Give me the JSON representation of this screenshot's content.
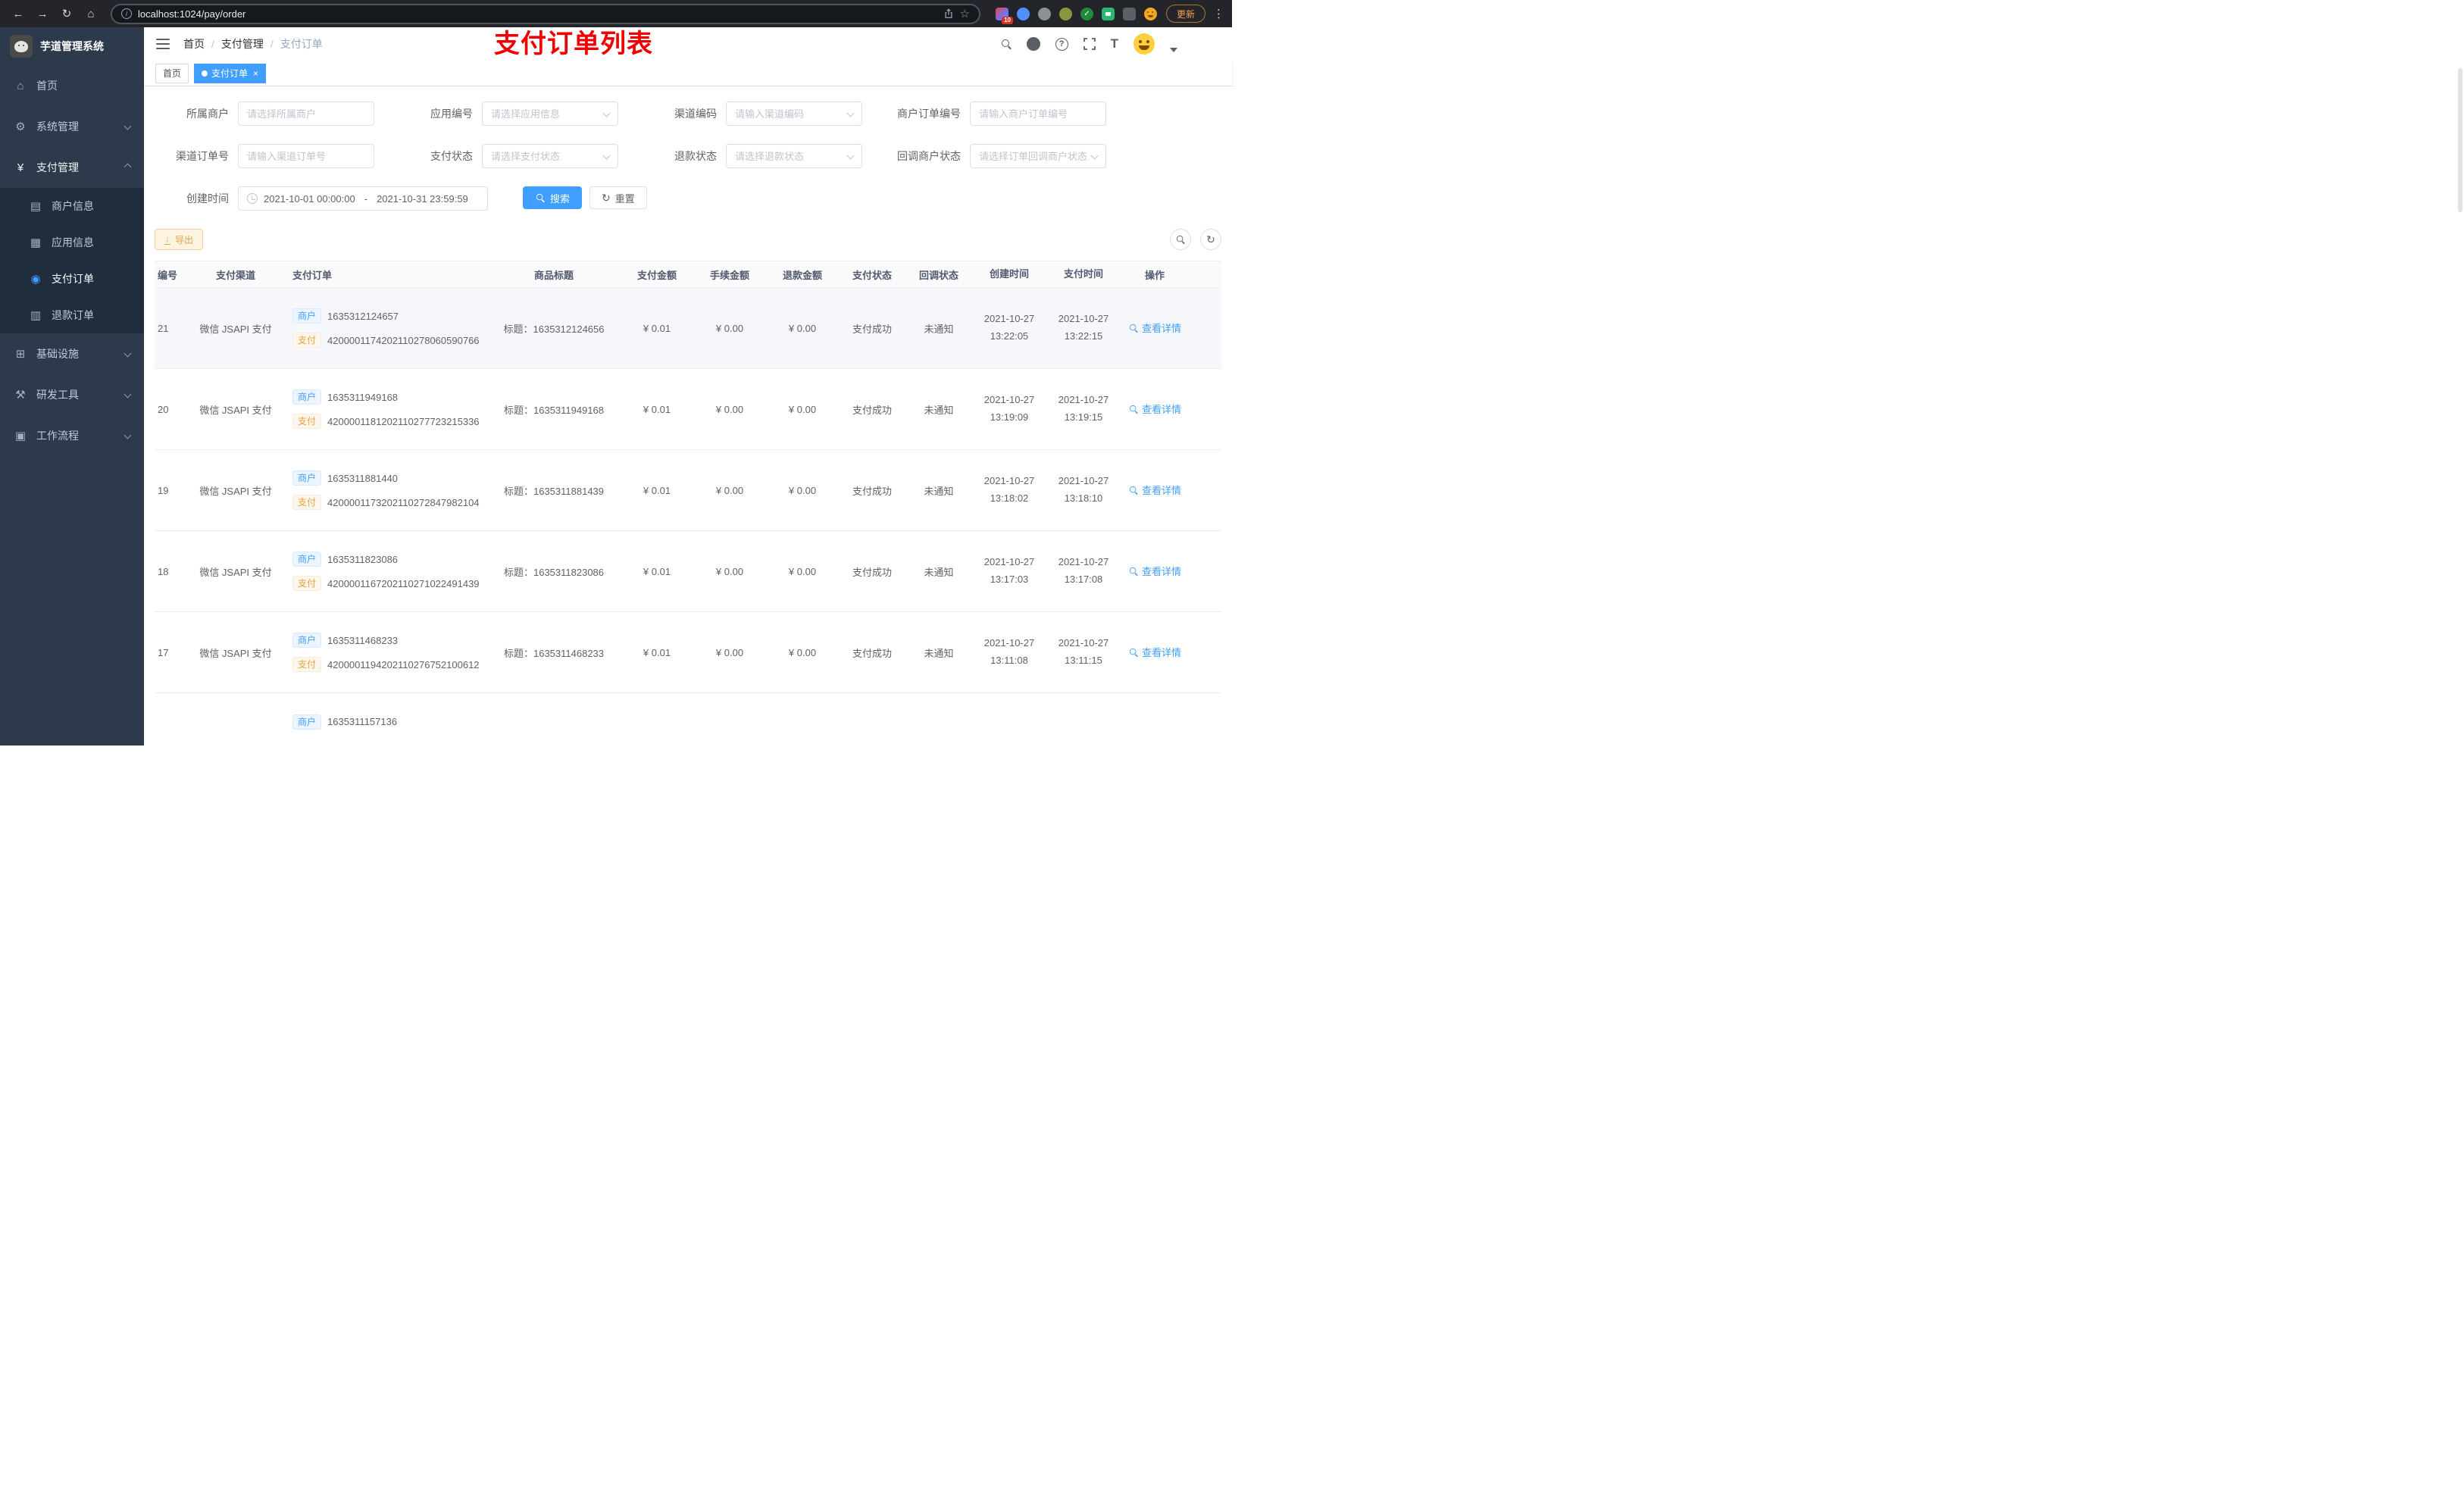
{
  "icons": {
    "back": "←",
    "forward": "→",
    "reload": "↻",
    "home": "⌂",
    "star": "☆",
    "dots": "⋮",
    "info": "i",
    "help": "?",
    "size": "T",
    "close": "×",
    "ext_check": "✓",
    "dashboard": "⌂",
    "system": "⚙",
    "pay": "¥",
    "merchant": "▤",
    "app": "▦",
    "order": "◉",
    "refund": "▥",
    "infra": "⊞",
    "devtool": "⚒",
    "workflow": "▣",
    "download": "↓",
    "refresh": "↻"
  },
  "browser": {
    "url": "localhost:1024/pay/order",
    "update_label": "更新",
    "extension_badge": "10"
  },
  "sidebar": {
    "title": "芋道管理系统",
    "menu": {
      "home": "首页",
      "system": "系统管理",
      "pay": "支付管理",
      "merchant": "商户信息",
      "app": "应用信息",
      "order": "支付订单",
      "refund": "退款订单",
      "infra": "基础设施",
      "devtool": "研发工具",
      "workflow": "工作流程"
    }
  },
  "header": {
    "breadcrumb_1": "首页",
    "breadcrumb_2": "支付管理",
    "breadcrumb_3": "支付订单",
    "separator": "/",
    "annotation": "支付订单列表"
  },
  "tabs": {
    "home": "首页",
    "order": "支付订单"
  },
  "filters": {
    "merchant_label": "所属商户",
    "merchant_placeholder": "请选择所属商户",
    "app_label": "应用编号",
    "app_placeholder": "请选择应用信息",
    "channel_code_label": "渠道编码",
    "channel_code_placeholder": "请输入渠道编码",
    "merchant_order_label": "商户订单编号",
    "merchant_order_placeholder": "请输入商户订单编号",
    "channel_order_label": "渠道订单号",
    "channel_order_placeholder": "请输入渠道订单号",
    "pay_status_label": "支付状态",
    "pay_status_placeholder": "请选择支付状态",
    "refund_status_label": "退款状态",
    "refund_status_placeholder": "请选择退款状态",
    "notify_status_label": "回调商户状态",
    "notify_status_placeholder": "请选择订单回调商户状态",
    "create_time_label": "创建时间",
    "date_start": "2021-10-01 00:00:00",
    "date_separator": "-",
    "date_end": "2021-10-31 23:59:59",
    "search_label": "搜索",
    "reset_label": "重置"
  },
  "toolbar": {
    "export_label": "导出"
  },
  "table": {
    "columns": [
      "编号",
      "支付渠道",
      "支付订单",
      "商品标题",
      "支付金额",
      "手续金额",
      "退款金额",
      "支付状态",
      "回调状态",
      "创建时间",
      "支付时间",
      "操作"
    ],
    "rows": [
      {
        "id": "21",
        "channel": "微信 JSAPI 支付",
        "merchant_tag": "商户",
        "merchant_no": "1635312124657",
        "pay_tag": "支付",
        "pay_no": "4200001174202110278060590766",
        "title": "标题：1635312124656",
        "amount": "¥ 0.01",
        "fee": "¥ 0.00",
        "refund": "¥ 0.00",
        "status": "支付成功",
        "notify": "未通知",
        "create_date": "2021-10-27",
        "create_time": "13:22:05",
        "pay_date": "2021-10-27",
        "pay_time": "13:22:15",
        "action": "查看详情"
      },
      {
        "id": "20",
        "channel": "微信 JSAPI 支付",
        "merchant_tag": "商户",
        "merchant_no": "1635311949168",
        "pay_tag": "支付",
        "pay_no": "4200001181202110277723215336",
        "title": "标题：1635311949168",
        "amount": "¥ 0.01",
        "fee": "¥ 0.00",
        "refund": "¥ 0.00",
        "status": "支付成功",
        "notify": "未通知",
        "create_date": "2021-10-27",
        "create_time": "13:19:09",
        "pay_date": "2021-10-27",
        "pay_time": "13:19:15",
        "action": "查看详情"
      },
      {
        "id": "19",
        "channel": "微信 JSAPI 支付",
        "merchant_tag": "商户",
        "merchant_no": "1635311881440",
        "pay_tag": "支付",
        "pay_no": "4200001173202110272847982104",
        "title": "标题：1635311881439",
        "amount": "¥ 0.01",
        "fee": "¥ 0.00",
        "refund": "¥ 0.00",
        "status": "支付成功",
        "notify": "未通知",
        "create_date": "2021-10-27",
        "create_time": "13:18:02",
        "pay_date": "2021-10-27",
        "pay_time": "13:18:10",
        "action": "查看详情"
      },
      {
        "id": "18",
        "channel": "微信 JSAPI 支付",
        "merchant_tag": "商户",
        "merchant_no": "1635311823086",
        "pay_tag": "支付",
        "pay_no": "4200001167202110271022491439",
        "title": "标题：1635311823086",
        "amount": "¥ 0.01",
        "fee": "¥ 0.00",
        "refund": "¥ 0.00",
        "status": "支付成功",
        "notify": "未通知",
        "create_date": "2021-10-27",
        "create_time": "13:17:03",
        "pay_date": "2021-10-27",
        "pay_time": "13:17:08",
        "action": "查看详情"
      },
      {
        "id": "17",
        "channel": "微信 JSAPI 支付",
        "merchant_tag": "商户",
        "merchant_no": "1635311468233",
        "pay_tag": "支付",
        "pay_no": "4200001194202110276752100612",
        "title": "标题：1635311468233",
        "amount": "¥ 0.01",
        "fee": "¥ 0.00",
        "refund": "¥ 0.00",
        "status": "支付成功",
        "notify": "未通知",
        "create_date": "2021-10-27",
        "create_time": "13:11:08",
        "pay_date": "2021-10-27",
        "pay_time": "13:11:15",
        "action": "查看详情"
      }
    ],
    "partial_row": {
      "id": "",
      "channel": "",
      "merchant_tag": "商户",
      "merchant_no": "1635311157136",
      "pay_tag": "",
      "pay_no": "",
      "title": "",
      "amount": "",
      "fee": "",
      "refund": "",
      "status": "",
      "notify": "",
      "create_date": "",
      "create_time": "",
      "pay_date": "",
      "pay_time": "",
      "action": ""
    }
  }
}
